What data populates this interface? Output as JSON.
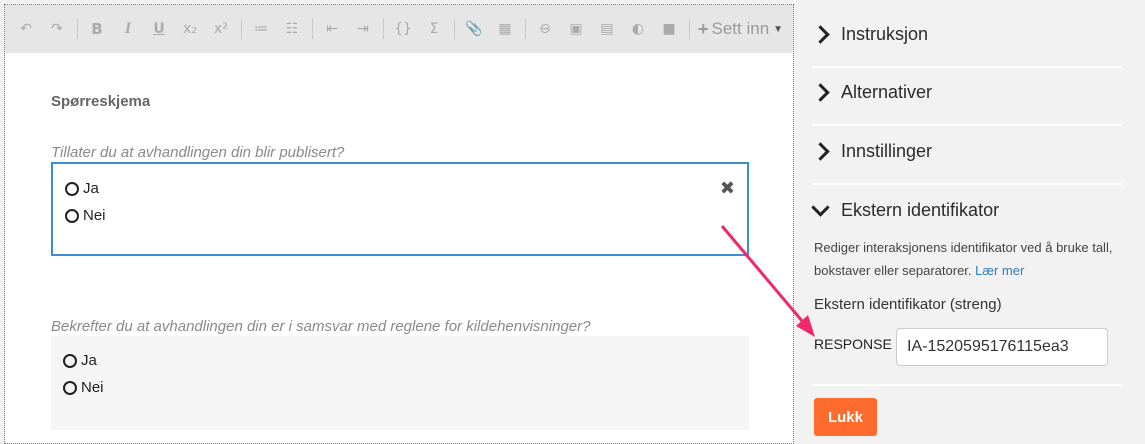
{
  "toolbar": {
    "buttons": [
      "↶",
      "↷",
      "B",
      "I",
      "U",
      "x₂",
      "x²",
      "≔",
      "☷",
      "⇤",
      "⇥",
      "{}",
      "Σ",
      "📎",
      "▦",
      "⊖",
      "▣",
      "▤",
      "◐",
      "■"
    ],
    "insert_label": "Sett inn"
  },
  "editor": {
    "section_title": "Spørreskjema",
    "questions": [
      {
        "label": "Tillater du at avhandlingen din blir publisert?",
        "options": [
          "Ja",
          "Nei"
        ]
      },
      {
        "label": "Bekrefter du at avhandlingen din er i samsvar med reglene for kildehenvisninger?",
        "options": [
          "Ja",
          "Nei"
        ]
      }
    ],
    "delete_icon": "✖"
  },
  "panel": {
    "items": [
      "Instruksjon",
      "Alternativer",
      "Innstillinger",
      "Ekstern identifikator"
    ],
    "description": "Rediger interaksjonens identifikator ved å bruke tall, bokstaver eller separatorer.",
    "learn_more": "Lær mer",
    "sub_label": "Ekstern identifikator (streng)",
    "response_label": "RESPONSE",
    "response_value": "IA-1520595176115ea3",
    "close_label": "Lukk"
  },
  "colors": {
    "accent": "#3b8fd1",
    "button": "#ff6b2c",
    "arrow": "#ee2a6b"
  }
}
